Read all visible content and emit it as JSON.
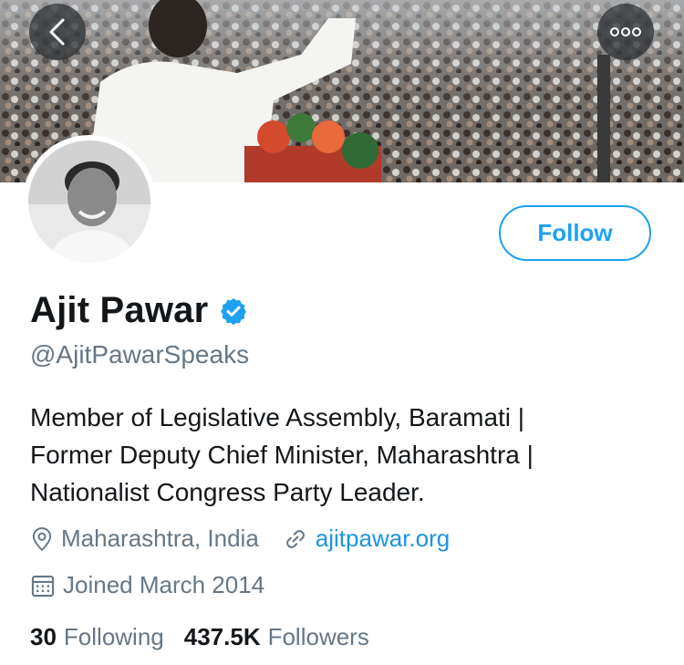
{
  "header": {
    "back_icon": "chevron-left-icon",
    "more_icon": "more-horizontal-icon"
  },
  "profile": {
    "display_name": "Ajit Pawar",
    "verified": true,
    "handle": "@AjitPawarSpeaks",
    "follow_label": "Follow",
    "bio_lines": [
      "Member of Legislative Assembly, Baramati |",
      "Former Deputy Chief Minister, Maharashtra |",
      "Nationalist Congress Party Leader."
    ],
    "location": "Maharashtra, India",
    "website": "ajitpawar.org",
    "joined": "Joined March 2014",
    "following_count": "30",
    "following_label": "Following",
    "followers_count": "437.5K",
    "followers_label": "Followers"
  },
  "colors": {
    "accent": "#1da1f2",
    "link": "#1b95e0",
    "secondary_text": "#657786",
    "primary_text": "#14171a"
  }
}
